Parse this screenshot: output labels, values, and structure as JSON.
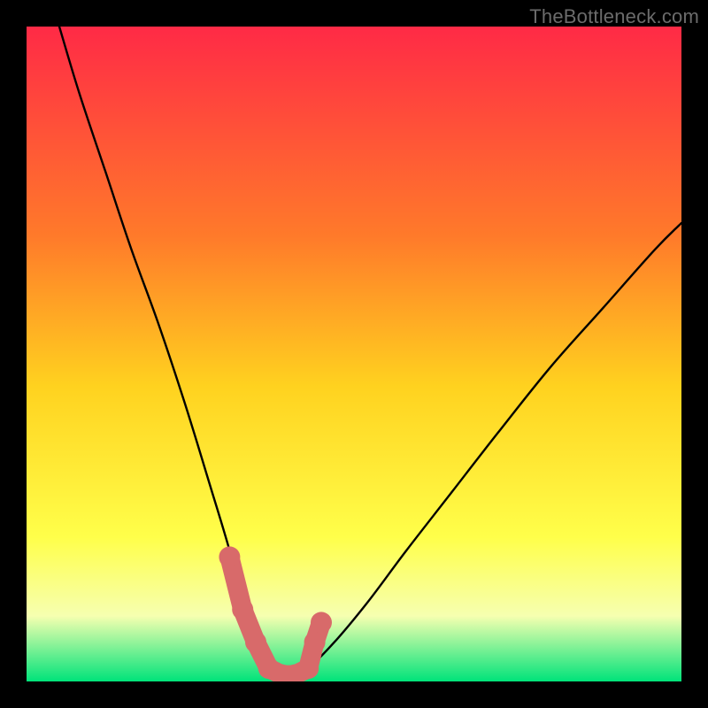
{
  "watermark": "TheBottleneck.com",
  "colors": {
    "background_frame": "#000000",
    "gradient_top": "#ff2a46",
    "gradient_mid1": "#ff7a2a",
    "gradient_mid2": "#ffd21f",
    "gradient_mid3": "#ffff4a",
    "gradient_mid4": "#f6ffb0",
    "gradient_bottom": "#00e37a",
    "curve_stroke": "#000000",
    "marker_stroke": "#d86a6a"
  },
  "chart_data": {
    "type": "line",
    "title": "",
    "xlabel": "",
    "ylabel": "",
    "xlim": [
      0,
      100
    ],
    "ylim": [
      0,
      100
    ],
    "series": [
      {
        "name": "bottleneck-curve",
        "x": [
          5,
          8,
          12,
          16,
          20,
          24,
          28,
          31,
          33,
          35,
          37,
          39,
          41,
          43,
          47,
          52,
          58,
          65,
          72,
          80,
          88,
          96,
          100
        ],
        "values": [
          100,
          90,
          78,
          66,
          55,
          43,
          30,
          20,
          12,
          7,
          3,
          1,
          1,
          2,
          6,
          12,
          20,
          29,
          38,
          48,
          57,
          66,
          70
        ]
      }
    ],
    "markers": {
      "name": "highlighted-points",
      "x": [
        31,
        33,
        35,
        37,
        39,
        41,
        43,
        44,
        45
      ],
      "values": [
        19,
        11,
        6,
        2,
        1,
        1,
        2,
        6,
        9
      ]
    },
    "gradient_background": true
  }
}
